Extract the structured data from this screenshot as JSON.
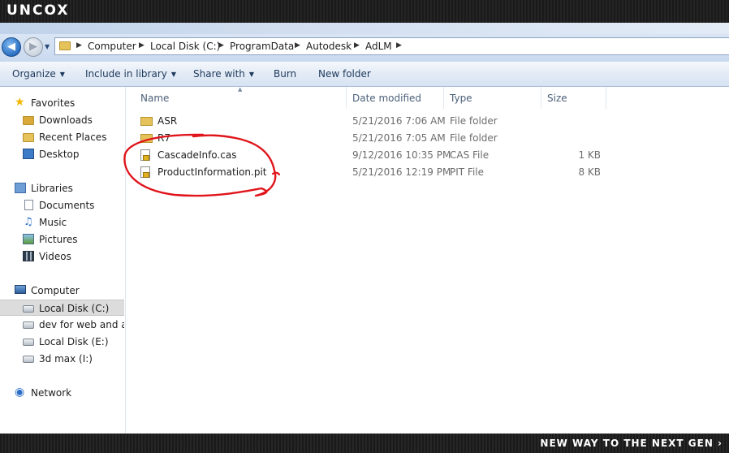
{
  "brand": {
    "logo": "UNCOX",
    "tagline": "NEW WAY TO THE NEXT GEN ›"
  },
  "address": {
    "crumbs": [
      "Computer",
      "Local Disk (C:)",
      "ProgramData",
      "Autodesk",
      "AdLM"
    ]
  },
  "toolbar": {
    "organize": "Organize",
    "include_in_library": "Include in library",
    "share_with": "Share with",
    "burn": "Burn",
    "new_folder": "New folder"
  },
  "nav": {
    "favorites": "Favorites",
    "downloads": "Downloads",
    "recent_places": "Recent Places",
    "desktop": "Desktop",
    "libraries": "Libraries",
    "documents": "Documents",
    "music": "Music",
    "pictures": "Pictures",
    "videos": "Videos",
    "computer": "Computer",
    "local_disk_c": "Local Disk (C:)",
    "dev_drive": "dev for web and and",
    "local_disk_e": "Local Disk (E:)",
    "max_drive": "3d max (I:)",
    "network": "Network"
  },
  "columns": {
    "name": "Name",
    "date_modified": "Date modified",
    "type": "Type",
    "size": "Size"
  },
  "files": [
    {
      "name": "ASR",
      "date": "5/21/2016 7:06 AM",
      "type": "File folder",
      "size": ""
    },
    {
      "name": "R7",
      "date": "5/21/2016 7:05 AM",
      "type": "File folder",
      "size": ""
    },
    {
      "name": "CascadeInfo.cas",
      "date": "9/12/2016 10:35 PM",
      "type": "CAS File",
      "size": "1 KB"
    },
    {
      "name": "ProductInformation.pit",
      "date": "5/21/2016 12:19 PM",
      "type": "PIT File",
      "size": "8 KB"
    }
  ],
  "colors": {
    "annotation": "#e0141a",
    "command_text": "#1e395b",
    "selected_bg": "#dcdcdc"
  }
}
